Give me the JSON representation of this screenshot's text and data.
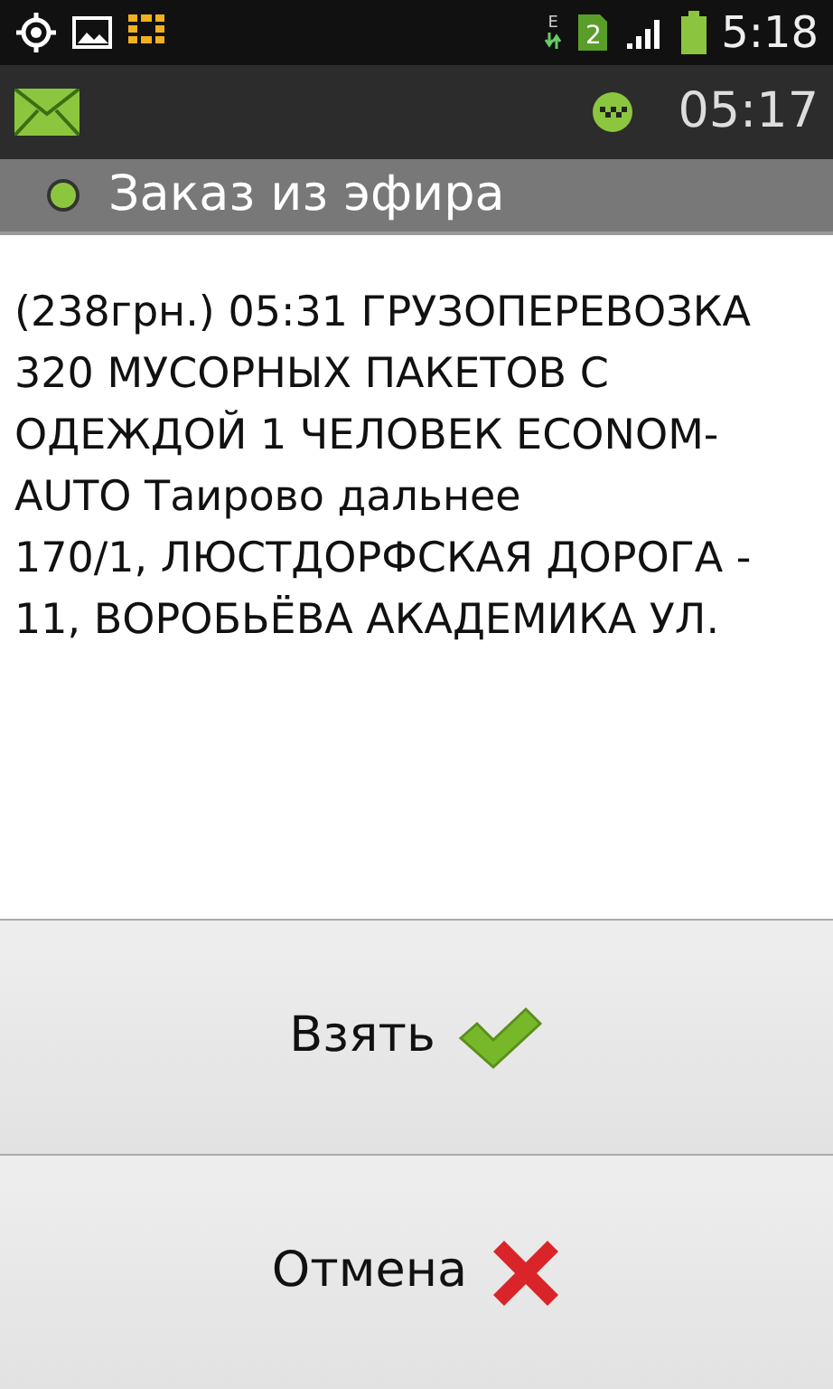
{
  "status_bar": {
    "time": "5:18",
    "sim_slot": "2",
    "network_type": "E"
  },
  "app_bar": {
    "time": "05:17"
  },
  "header": {
    "title": "Заказ из эфира"
  },
  "order": {
    "lines": [
      "(238грн.) 05:31 ГРУЗОПЕРЕВОЗКА 320 МУСОРНЫХ ПАКЕТОВ С ОДЕЖДОЙ 1 ЧЕЛОВЕК ECONOM-AUTO Таирово дальнее",
      "170/1, ЛЮСТДОРФСКАЯ ДОРОГА - 11, ВОРОБЬЁВА АКАДЕМИКА УЛ."
    ]
  },
  "buttons": [
    {
      "label": "Взять",
      "kind": "accept"
    },
    {
      "label": "Отмена",
      "kind": "cancel"
    }
  ]
}
